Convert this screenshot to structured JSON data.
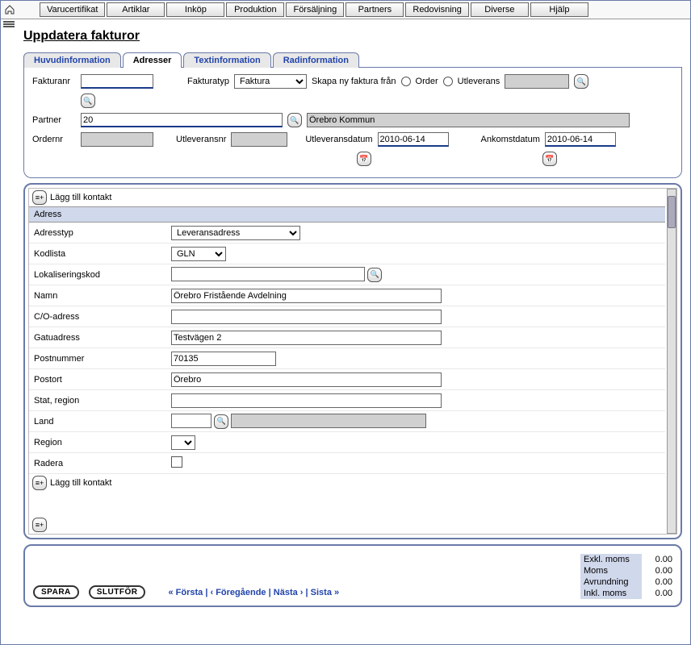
{
  "menu": [
    "Varucertifikat",
    "Artiklar",
    "Inköp",
    "Produktion",
    "Försäljning",
    "Partners",
    "Redovisning",
    "Diverse",
    "Hjälp"
  ],
  "page_title": "Uppdatera fakturor",
  "tabs": [
    "Huvudinformation",
    "Adresser",
    "Textinformation",
    "Radinformation"
  ],
  "active_tab": 1,
  "header": {
    "fakturanr_label": "Fakturanr",
    "fakturanr_value": "",
    "fakturatyp_label": "Fakturatyp",
    "fakturatyp_value": "Faktura",
    "skapa_label": "Skapa ny faktura från",
    "order_label": "Order",
    "utleverans_label": "Utleverans",
    "partner_label": "Partner",
    "partner_value": "20",
    "partner_name": "Örebro Kommun",
    "ordernr_label": "Ordernr",
    "ordernr_value": "",
    "utleveransnr_label": "Utleveransnr",
    "utleveransnr_value": "",
    "utleveransdatum_label": "Utleveransdatum",
    "utleveransdatum_value": "2010-06-14",
    "ankomstdatum_label": "Ankomstdatum",
    "ankomstdatum_value": "2010-06-14"
  },
  "add_contact_label": "Lägg till kontakt",
  "address_section": "Adress",
  "form": {
    "adresstyp_label": "Adresstyp",
    "adresstyp_value": "Leveransadress",
    "kodlista_label": "Kodlista",
    "kodlista_value": "GLN",
    "lokaliseringskod_label": "Lokaliseringskod",
    "lokaliseringskod_value": "",
    "namn_label": "Namn",
    "namn_value": "Örebro Fristående Avdelning",
    "co_label": "C/O-adress",
    "co_value": "",
    "gatuadress_label": "Gatuadress",
    "gatuadress_value": "Testvägen 2",
    "postnummer_label": "Postnummer",
    "postnummer_value": "70135",
    "postort_label": "Postort",
    "postort_value": "Örebro",
    "stat_label": "Stat, region",
    "stat_value": "",
    "land_label": "Land",
    "land_code": "",
    "land_value": "",
    "region_label": "Region",
    "region_value": "",
    "radera_label": "Radera"
  },
  "footer": {
    "spara": "SPARA",
    "slutfor": "SLUTFÖR",
    "nav_first": "« Första",
    "nav_prev": "‹ Föregående",
    "nav_next": "Nästa ›",
    "nav_last": "Sista »",
    "sep": " | "
  },
  "totals": {
    "exkl_label": "Exkl. moms",
    "exkl_val": "0.00",
    "moms_label": "Moms",
    "moms_val": "0.00",
    "avr_label": "Avrundning",
    "avr_val": "0.00",
    "inkl_label": "Inkl. moms",
    "inkl_val": "0.00"
  }
}
